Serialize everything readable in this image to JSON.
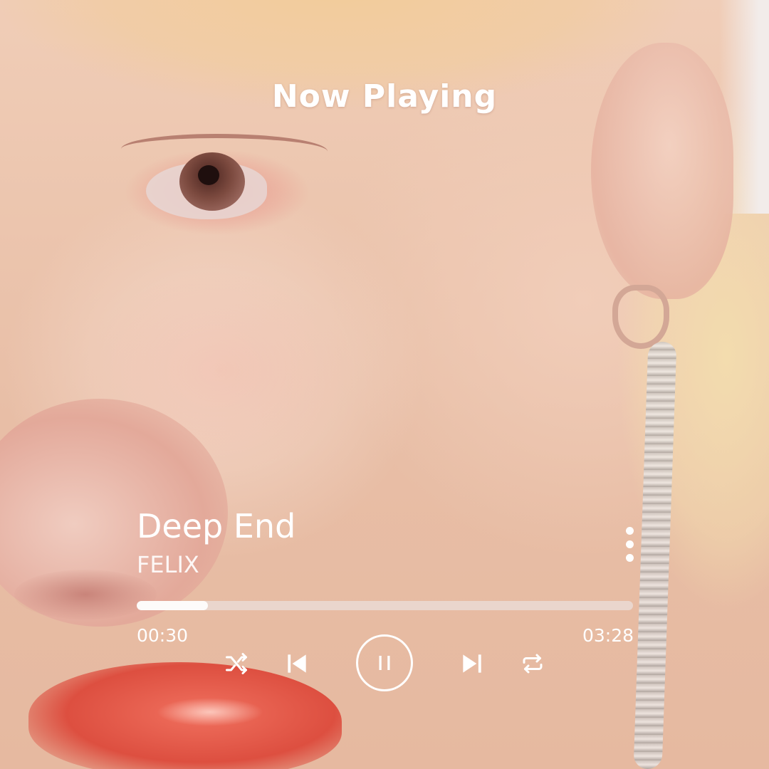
{
  "header": {
    "title": "Now Playing"
  },
  "track": {
    "title": "Deep End",
    "artist": "FELIX"
  },
  "progress": {
    "current": "00:30",
    "total": "03:28",
    "fraction": 0.144
  },
  "controls": {
    "shuffle_icon": "shuffle-icon",
    "previous_icon": "skip-previous-icon",
    "play_pause_icon": "pause-icon",
    "next_icon": "skip-next-icon",
    "repeat_icon": "repeat-icon",
    "more_icon": "more-vertical-icon"
  },
  "colors": {
    "foreground": "#ffffff",
    "track_bg": "#ebe1de",
    "lip_accent": "#dd4f40"
  }
}
